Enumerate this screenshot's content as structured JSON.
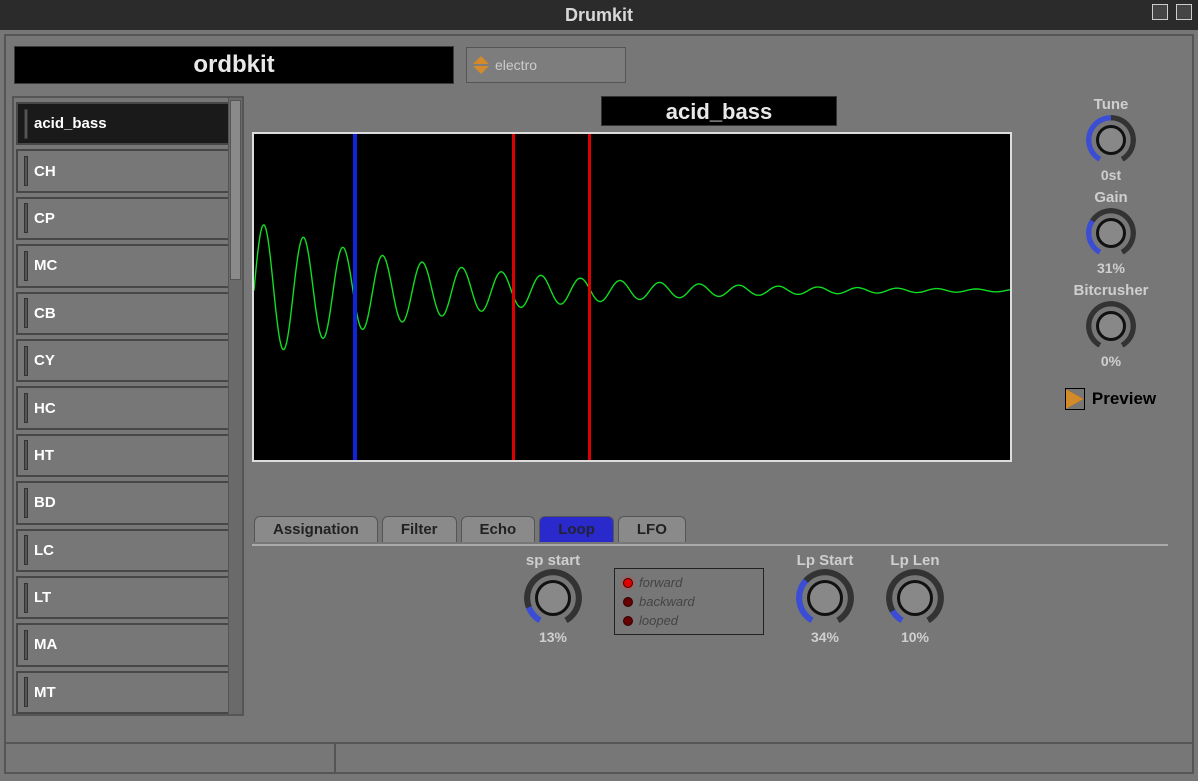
{
  "window": {
    "title": "Drumkit"
  },
  "kit_name": "ordbkit",
  "preset": {
    "label": "electro"
  },
  "sidebar": {
    "selected_index": 0,
    "items": [
      {
        "label": "acid_bass"
      },
      {
        "label": "CH"
      },
      {
        "label": "CP"
      },
      {
        "label": "MC"
      },
      {
        "label": "CB"
      },
      {
        "label": "CY"
      },
      {
        "label": "HC"
      },
      {
        "label": "HT"
      },
      {
        "label": "BD"
      },
      {
        "label": "LC"
      },
      {
        "label": "LT"
      },
      {
        "label": "MA"
      },
      {
        "label": "MT"
      }
    ]
  },
  "sample": {
    "name": "acid_bass",
    "markers": {
      "play_pos_pct": 13,
      "loop_start_pct": 34,
      "loop_end_pct": 44
    }
  },
  "right_knobs": {
    "tune": {
      "label": "Tune",
      "value_text": "0st",
      "fill_deg": 150
    },
    "gain": {
      "label": "Gain",
      "value_text": "31%",
      "fill_deg": 93
    },
    "bitcrusher": {
      "label": "Bitcrusher",
      "value_text": "0%",
      "fill_deg": 0
    }
  },
  "preview_label": "Preview",
  "tabs": {
    "active_index": 3,
    "items": [
      {
        "label": "Assignation"
      },
      {
        "label": "Filter"
      },
      {
        "label": "Echo"
      },
      {
        "label": "Loop"
      },
      {
        "label": "LFO"
      }
    ]
  },
  "loop_panel": {
    "sp_start": {
      "label": "sp start",
      "value_text": "13%",
      "fill_deg": 39
    },
    "direction": {
      "options": [
        {
          "label": "forward",
          "selected": true
        },
        {
          "label": "backward",
          "selected": false
        },
        {
          "label": "looped",
          "selected": false
        }
      ]
    },
    "lp_start": {
      "label": "Lp Start",
      "value_text": "34%",
      "fill_deg": 102
    },
    "lp_len": {
      "label": "Lp Len",
      "value_text": "10%",
      "fill_deg": 30
    }
  }
}
